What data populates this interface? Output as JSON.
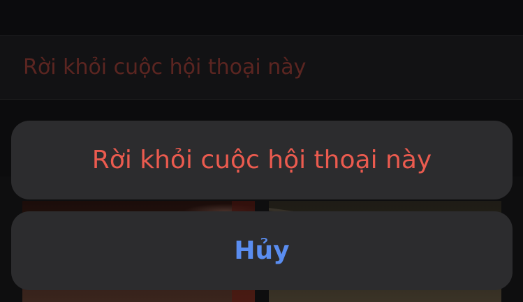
{
  "background": {
    "row_label": "Rời khỏi cuộc hội thoại này"
  },
  "action_sheet": {
    "destructive_label": "Rời khỏi cuộc hội thoại này",
    "cancel_label": "Hủy"
  },
  "colors": {
    "destructive": "#eb5b4f",
    "cancel": "#5a8df0",
    "sheet_bg": "#2c2c2e"
  }
}
